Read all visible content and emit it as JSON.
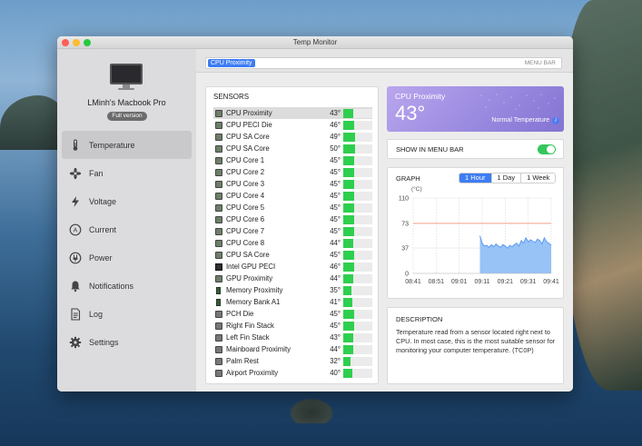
{
  "window": {
    "title": "Temp Monitor"
  },
  "sidebar": {
    "device_name": "LMinh's Macbook Pro",
    "version_badge": "Full version",
    "items": [
      {
        "label": "Temperature",
        "icon": "thermometer-icon",
        "active": true
      },
      {
        "label": "Fan",
        "icon": "fan-icon",
        "active": false
      },
      {
        "label": "Voltage",
        "icon": "lightning-icon",
        "active": false
      },
      {
        "label": "Current",
        "icon": "ampere-icon",
        "active": false
      },
      {
        "label": "Power",
        "icon": "power-icon",
        "active": false
      },
      {
        "label": "Notifications",
        "icon": "bell-icon",
        "active": false
      },
      {
        "label": "Log",
        "icon": "log-icon",
        "active": false
      },
      {
        "label": "Settings",
        "icon": "gear-icon",
        "active": false
      }
    ]
  },
  "menubar": {
    "token": "CPU Proximity",
    "label": "MENU BAR"
  },
  "sensors": {
    "title": "SENSORS",
    "rows": [
      {
        "name": "CPU Proximity",
        "temp": "43°",
        "level": 0.43,
        "icon": "chip",
        "selected": true
      },
      {
        "name": "CPU PECI Die",
        "temp": "46°",
        "level": 0.46,
        "icon": "chip"
      },
      {
        "name": "CPU SA Core",
        "temp": "49°",
        "level": 0.49,
        "icon": "chip"
      },
      {
        "name": "CPU SA Core",
        "temp": "50°",
        "level": 0.5,
        "icon": "chip"
      },
      {
        "name": "CPU Core 1",
        "temp": "45°",
        "level": 0.45,
        "icon": "chip"
      },
      {
        "name": "CPU Core 2",
        "temp": "45°",
        "level": 0.45,
        "icon": "chip"
      },
      {
        "name": "CPU Core 3",
        "temp": "45°",
        "level": 0.45,
        "icon": "chip"
      },
      {
        "name": "CPU Core 4",
        "temp": "45°",
        "level": 0.45,
        "icon": "chip"
      },
      {
        "name": "CPU Core 5",
        "temp": "45°",
        "level": 0.45,
        "icon": "chip"
      },
      {
        "name": "CPU Core 6",
        "temp": "45°",
        "level": 0.45,
        "icon": "chip"
      },
      {
        "name": "CPU Core 7",
        "temp": "45°",
        "level": 0.45,
        "icon": "chip"
      },
      {
        "name": "CPU Core 8",
        "temp": "44°",
        "level": 0.44,
        "icon": "chip"
      },
      {
        "name": "CPU SA Core",
        "temp": "45°",
        "level": 0.45,
        "icon": "chip"
      },
      {
        "name": "Intel GPU PECI",
        "temp": "46°",
        "level": 0.46,
        "icon": "gpu"
      },
      {
        "name": "GPU Proximity",
        "temp": "44°",
        "level": 0.44,
        "icon": "chip"
      },
      {
        "name": "Memory Proximity",
        "temp": "35°",
        "level": 0.35,
        "icon": "mem"
      },
      {
        "name": "Memory Bank A1",
        "temp": "41°",
        "level": 0.41,
        "icon": "mem"
      },
      {
        "name": "PCH Die",
        "temp": "45°",
        "level": 0.45,
        "icon": "fan"
      },
      {
        "name": "Right Fin Stack",
        "temp": "45°",
        "level": 0.45,
        "icon": "fan"
      },
      {
        "name": "Left Fin Stack",
        "temp": "43°",
        "level": 0.43,
        "icon": "fan"
      },
      {
        "name": "Mainboard Proximity",
        "temp": "44°",
        "level": 0.44,
        "icon": "fan"
      },
      {
        "name": "Palm Rest",
        "temp": "32°",
        "level": 0.32,
        "icon": "fan"
      },
      {
        "name": "Airport Proximity",
        "temp": "40°",
        "level": 0.4,
        "icon": "fan"
      }
    ]
  },
  "temp_card": {
    "label": "CPU Proximity",
    "value": "43°",
    "status": "Normal Temperature"
  },
  "menu_bar_toggle": {
    "label": "SHOW IN MENU BAR",
    "on": true
  },
  "graph": {
    "title": "GRAPH",
    "ranges": [
      "1 Hour",
      "1 Day",
      "1 Week"
    ],
    "selected_range": "1 Hour",
    "unit": "(°C)",
    "y_ticks": [
      "110",
      "73",
      "37",
      "0"
    ],
    "x_ticks": [
      "08:41",
      "08:51",
      "09:01",
      "09:11",
      "09:21",
      "09:31",
      "09:41"
    ],
    "threshold": 73,
    "series_color": "#5b9cf0",
    "threshold_color": "#f4a08a"
  },
  "chart_data": {
    "type": "area",
    "x": [
      "09:10",
      "09:11",
      "09:12",
      "09:13",
      "09:14",
      "09:15",
      "09:16",
      "09:17",
      "09:18",
      "09:19",
      "09:20",
      "09:21",
      "09:22",
      "09:23",
      "09:24",
      "09:25",
      "09:26",
      "09:27",
      "09:28",
      "09:29",
      "09:30",
      "09:31",
      "09:32",
      "09:33",
      "09:34",
      "09:35",
      "09:36",
      "09:37",
      "09:38",
      "09:39",
      "09:40",
      "09:41"
    ],
    "values": [
      55,
      44,
      40,
      41,
      38,
      42,
      39,
      43,
      40,
      38,
      42,
      40,
      37,
      41,
      39,
      42,
      44,
      40,
      48,
      44,
      52,
      46,
      49,
      47,
      45,
      50,
      48,
      43,
      52,
      46,
      44,
      41
    ],
    "ylim": [
      0,
      110
    ],
    "y_unit": "(°C)",
    "reference_line": 73
  },
  "description": {
    "title": "DESCRIPTION",
    "text": "Temperature read from a sensor located right next to CPU. In most case, this is the most suitable sensor for monitoring your computer temperature. (TC0P)"
  }
}
